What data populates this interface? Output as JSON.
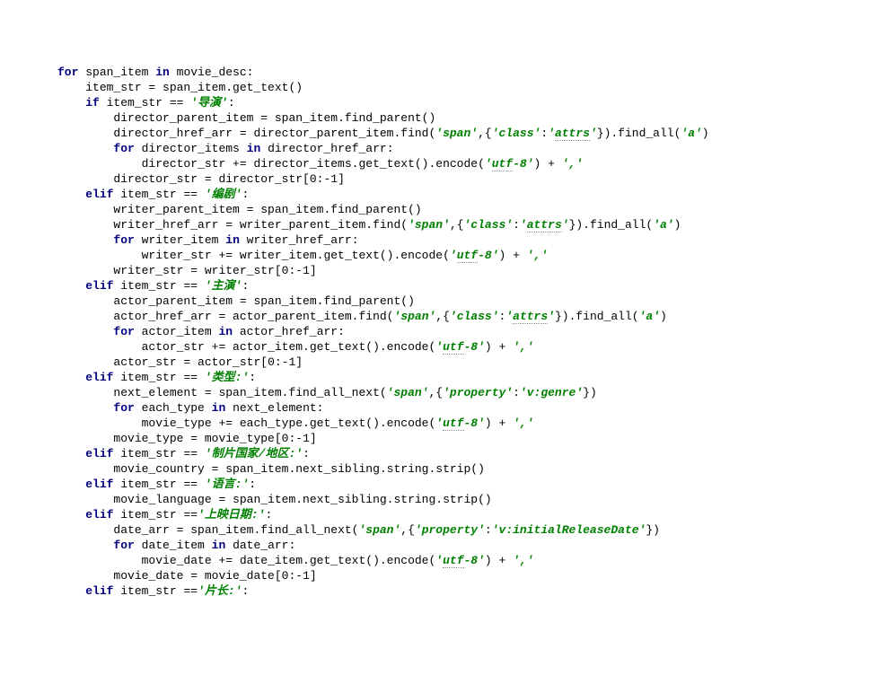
{
  "code": {
    "lines": [
      {
        "indent": 0,
        "tokens": [
          {
            "t": "kw",
            "v": "for "
          },
          {
            "t": "",
            "v": "span_item "
          },
          {
            "t": "kw",
            "v": "in "
          },
          {
            "t": "",
            "v": "movie_desc:"
          }
        ]
      },
      {
        "indent": 1,
        "tokens": [
          {
            "t": "",
            "v": "item_str = span_item.get_text()"
          }
        ]
      },
      {
        "indent": 1,
        "tokens": [
          {
            "t": "kw",
            "v": "if "
          },
          {
            "t": "",
            "v": "item_str == "
          },
          {
            "t": "str",
            "v": "'导演'"
          },
          {
            "t": "",
            "v": ":"
          }
        ]
      },
      {
        "indent": 2,
        "tokens": [
          {
            "t": "",
            "v": "director_parent_item = span_item.find_parent()"
          }
        ]
      },
      {
        "indent": 2,
        "tokens": [
          {
            "t": "",
            "v": "director_href_arr = director_parent_item.find("
          },
          {
            "t": "str",
            "v": "'span'"
          },
          {
            "t": "",
            "v": ",{"
          },
          {
            "t": "str",
            "v": "'class'"
          },
          {
            "t": "",
            "v": ":"
          },
          {
            "t": "str",
            "v": "'"
          },
          {
            "t": "str underline",
            "v": "attrs"
          },
          {
            "t": "str",
            "v": "'"
          },
          {
            "t": "",
            "v": "}).find_all("
          },
          {
            "t": "str",
            "v": "'a'"
          },
          {
            "t": "",
            "v": ")"
          }
        ]
      },
      {
        "indent": 2,
        "tokens": [
          {
            "t": "kw",
            "v": "for "
          },
          {
            "t": "",
            "v": "director_items "
          },
          {
            "t": "kw",
            "v": "in "
          },
          {
            "t": "",
            "v": "director_href_arr:"
          }
        ]
      },
      {
        "indent": 3,
        "tokens": [
          {
            "t": "",
            "v": "director_str += director_items.get_text().encode("
          },
          {
            "t": "str",
            "v": "'"
          },
          {
            "t": "str underline",
            "v": "utf"
          },
          {
            "t": "str",
            "v": "-8'"
          },
          {
            "t": "",
            "v": ") + "
          },
          {
            "t": "str",
            "v": "','"
          }
        ]
      },
      {
        "indent": 2,
        "tokens": [
          {
            "t": "",
            "v": "director_str = director_str["
          },
          {
            "t": "",
            "v": "0"
          },
          {
            "t": "",
            "v": ":-"
          },
          {
            "t": "",
            "v": "1"
          },
          {
            "t": "",
            "v": "]"
          }
        ]
      },
      {
        "indent": 1,
        "tokens": [
          {
            "t": "kw",
            "v": "elif "
          },
          {
            "t": "",
            "v": "item_str == "
          },
          {
            "t": "str",
            "v": "'编剧'"
          },
          {
            "t": "",
            "v": ":"
          }
        ]
      },
      {
        "indent": 2,
        "tokens": [
          {
            "t": "",
            "v": "writer_parent_item = span_item.find_parent()"
          }
        ]
      },
      {
        "indent": 2,
        "tokens": [
          {
            "t": "",
            "v": "writer_href_arr = writer_parent_item.find("
          },
          {
            "t": "str",
            "v": "'span'"
          },
          {
            "t": "",
            "v": ",{"
          },
          {
            "t": "str",
            "v": "'class'"
          },
          {
            "t": "",
            "v": ":"
          },
          {
            "t": "str",
            "v": "'"
          },
          {
            "t": "str underline",
            "v": "attrs"
          },
          {
            "t": "str",
            "v": "'"
          },
          {
            "t": "",
            "v": "}).find_all("
          },
          {
            "t": "str",
            "v": "'a'"
          },
          {
            "t": "",
            "v": ")"
          }
        ]
      },
      {
        "indent": 2,
        "tokens": [
          {
            "t": "kw",
            "v": "for "
          },
          {
            "t": "",
            "v": "writer_item "
          },
          {
            "t": "kw",
            "v": "in "
          },
          {
            "t": "",
            "v": "writer_href_arr:"
          }
        ]
      },
      {
        "indent": 3,
        "tokens": [
          {
            "t": "",
            "v": "writer_str += writer_item.get_text().encode("
          },
          {
            "t": "str",
            "v": "'"
          },
          {
            "t": "str underline",
            "v": "utf"
          },
          {
            "t": "str",
            "v": "-8'"
          },
          {
            "t": "",
            "v": ") + "
          },
          {
            "t": "str",
            "v": "','"
          }
        ]
      },
      {
        "indent": 2,
        "tokens": [
          {
            "t": "",
            "v": "writer_str = writer_str["
          },
          {
            "t": "",
            "v": "0"
          },
          {
            "t": "",
            "v": ":-"
          },
          {
            "t": "",
            "v": "1"
          },
          {
            "t": "",
            "v": "]"
          }
        ]
      },
      {
        "indent": 1,
        "tokens": [
          {
            "t": "kw",
            "v": "elif "
          },
          {
            "t": "",
            "v": "item_str == "
          },
          {
            "t": "str",
            "v": "'主演'"
          },
          {
            "t": "",
            "v": ":"
          }
        ]
      },
      {
        "indent": 2,
        "tokens": [
          {
            "t": "",
            "v": "actor_parent_item = span_item.find_parent()"
          }
        ]
      },
      {
        "indent": 2,
        "tokens": [
          {
            "t": "",
            "v": "actor_href_arr = actor_parent_item.find("
          },
          {
            "t": "str",
            "v": "'span'"
          },
          {
            "t": "",
            "v": ",{"
          },
          {
            "t": "str",
            "v": "'class'"
          },
          {
            "t": "",
            "v": ":"
          },
          {
            "t": "str",
            "v": "'"
          },
          {
            "t": "str underline",
            "v": "attrs"
          },
          {
            "t": "str",
            "v": "'"
          },
          {
            "t": "",
            "v": "}).find_all("
          },
          {
            "t": "str",
            "v": "'a'"
          },
          {
            "t": "",
            "v": ")"
          }
        ]
      },
      {
        "indent": 2,
        "tokens": [
          {
            "t": "kw",
            "v": "for "
          },
          {
            "t": "",
            "v": "actor_item "
          },
          {
            "t": "kw",
            "v": "in "
          },
          {
            "t": "",
            "v": "actor_href_arr:"
          }
        ]
      },
      {
        "indent": 3,
        "tokens": [
          {
            "t": "",
            "v": "actor_str += actor_item.get_text().encode("
          },
          {
            "t": "str",
            "v": "'"
          },
          {
            "t": "str underline",
            "v": "utf"
          },
          {
            "t": "str",
            "v": "-8'"
          },
          {
            "t": "",
            "v": ") + "
          },
          {
            "t": "str",
            "v": "','"
          }
        ]
      },
      {
        "indent": 2,
        "tokens": [
          {
            "t": "",
            "v": "actor_str = actor_str["
          },
          {
            "t": "",
            "v": "0"
          },
          {
            "t": "",
            "v": ":-"
          },
          {
            "t": "",
            "v": "1"
          },
          {
            "t": "",
            "v": "]"
          }
        ]
      },
      {
        "indent": 1,
        "tokens": [
          {
            "t": "kw",
            "v": "elif "
          },
          {
            "t": "",
            "v": "item_str == "
          },
          {
            "t": "str",
            "v": "'类型:'"
          },
          {
            "t": "",
            "v": ":"
          }
        ]
      },
      {
        "indent": 2,
        "tokens": [
          {
            "t": "",
            "v": "next_element = span_item.find_all_next("
          },
          {
            "t": "str",
            "v": "'span'"
          },
          {
            "t": "",
            "v": ",{"
          },
          {
            "t": "str",
            "v": "'property'"
          },
          {
            "t": "",
            "v": ":"
          },
          {
            "t": "str",
            "v": "'v:genre'"
          },
          {
            "t": "",
            "v": "})"
          }
        ]
      },
      {
        "indent": 2,
        "tokens": [
          {
            "t": "kw",
            "v": "for "
          },
          {
            "t": "",
            "v": "each_type "
          },
          {
            "t": "kw",
            "v": "in "
          },
          {
            "t": "",
            "v": "next_element:"
          }
        ]
      },
      {
        "indent": 3,
        "tokens": [
          {
            "t": "",
            "v": "movie_type += each_type.get_text().encode("
          },
          {
            "t": "str",
            "v": "'"
          },
          {
            "t": "str underline",
            "v": "utf"
          },
          {
            "t": "str",
            "v": "-8'"
          },
          {
            "t": "",
            "v": ") + "
          },
          {
            "t": "str",
            "v": "','"
          }
        ]
      },
      {
        "indent": 2,
        "tokens": [
          {
            "t": "",
            "v": "movie_type = movie_type["
          },
          {
            "t": "",
            "v": "0"
          },
          {
            "t": "",
            "v": ":-"
          },
          {
            "t": "",
            "v": "1"
          },
          {
            "t": "",
            "v": "]"
          }
        ]
      },
      {
        "indent": 1,
        "tokens": [
          {
            "t": "kw",
            "v": "elif "
          },
          {
            "t": "",
            "v": "item_str == "
          },
          {
            "t": "str",
            "v": "'制片国家/地区:'"
          },
          {
            "t": "",
            "v": ":"
          }
        ]
      },
      {
        "indent": 2,
        "tokens": [
          {
            "t": "",
            "v": "movie_country = span_item.next_sibling.string.strip()"
          }
        ]
      },
      {
        "indent": 1,
        "tokens": [
          {
            "t": "kw",
            "v": "elif "
          },
          {
            "t": "",
            "v": "item_str == "
          },
          {
            "t": "str",
            "v": "'语言:'"
          },
          {
            "t": "",
            "v": ":"
          }
        ]
      },
      {
        "indent": 2,
        "tokens": [
          {
            "t": "",
            "v": "movie_language = span_item.next_sibling.string.strip()"
          }
        ]
      },
      {
        "indent": 1,
        "tokens": [
          {
            "t": "kw",
            "v": "elif "
          },
          {
            "t": "",
            "v": "item_str =="
          },
          {
            "t": "str",
            "v": "'上映日期:'"
          },
          {
            "t": "",
            "v": ":"
          }
        ]
      },
      {
        "indent": 2,
        "tokens": [
          {
            "t": "",
            "v": "date_arr = span_item.find_all_next("
          },
          {
            "t": "str",
            "v": "'span'"
          },
          {
            "t": "",
            "v": ",{"
          },
          {
            "t": "str",
            "v": "'property'"
          },
          {
            "t": "",
            "v": ":"
          },
          {
            "t": "str",
            "v": "'v:initialReleaseDate'"
          },
          {
            "t": "",
            "v": "})"
          }
        ]
      },
      {
        "indent": 2,
        "tokens": [
          {
            "t": "kw",
            "v": "for "
          },
          {
            "t": "",
            "v": "date_item "
          },
          {
            "t": "kw",
            "v": "in "
          },
          {
            "t": "",
            "v": "date_arr:"
          }
        ]
      },
      {
        "indent": 3,
        "tokens": [
          {
            "t": "",
            "v": "movie_date += date_item.get_text().encode("
          },
          {
            "t": "str",
            "v": "'"
          },
          {
            "t": "str underline",
            "v": "utf"
          },
          {
            "t": "str",
            "v": "-8'"
          },
          {
            "t": "",
            "v": ") + "
          },
          {
            "t": "str",
            "v": "','"
          }
        ]
      },
      {
        "indent": 2,
        "tokens": [
          {
            "t": "",
            "v": "movie_date = movie_date["
          },
          {
            "t": "",
            "v": "0"
          },
          {
            "t": "",
            "v": ":-"
          },
          {
            "t": "",
            "v": "1"
          },
          {
            "t": "",
            "v": "]"
          }
        ]
      },
      {
        "indent": 1,
        "tokens": [
          {
            "t": "kw",
            "v": "elif "
          },
          {
            "t": "",
            "v": "item_str =="
          },
          {
            "t": "str",
            "v": "'片长:'"
          },
          {
            "t": "",
            "v": ":"
          }
        ]
      }
    ],
    "indent_unit": "    "
  }
}
